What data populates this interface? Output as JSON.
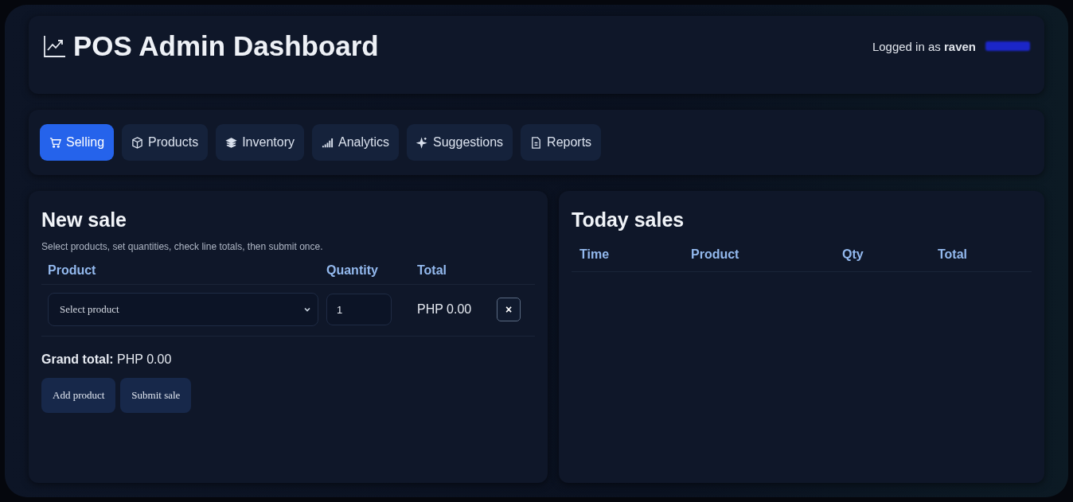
{
  "header": {
    "title": "POS Admin Dashboard",
    "user_prefix": "Logged in as",
    "username": "raven"
  },
  "tabs": [
    {
      "label": "Selling",
      "selected": true
    },
    {
      "label": "Products",
      "selected": false
    },
    {
      "label": "Inventory",
      "selected": false
    },
    {
      "label": "Analytics",
      "selected": false
    },
    {
      "label": "Suggestions",
      "selected": false
    },
    {
      "label": "Reports",
      "selected": false
    }
  ],
  "new_sale": {
    "title": "New sale",
    "description": "Select products, set quantities, check line totals, then submit once.",
    "columns": [
      "Product",
      "Quantity",
      "Total"
    ],
    "lines": [
      {
        "product_placeholder": "Select product",
        "quantity": "1",
        "total": "PHP 0.00",
        "remove": "×"
      }
    ],
    "grand_total_label": "Grand total:",
    "grand_total": "PHP 0.00",
    "buttons": [
      "Add product",
      "Submit sale"
    ]
  },
  "today_sales": {
    "title": "Today sales",
    "columns": [
      "Time",
      "Product",
      "Qty",
      "Total"
    ]
  }
}
